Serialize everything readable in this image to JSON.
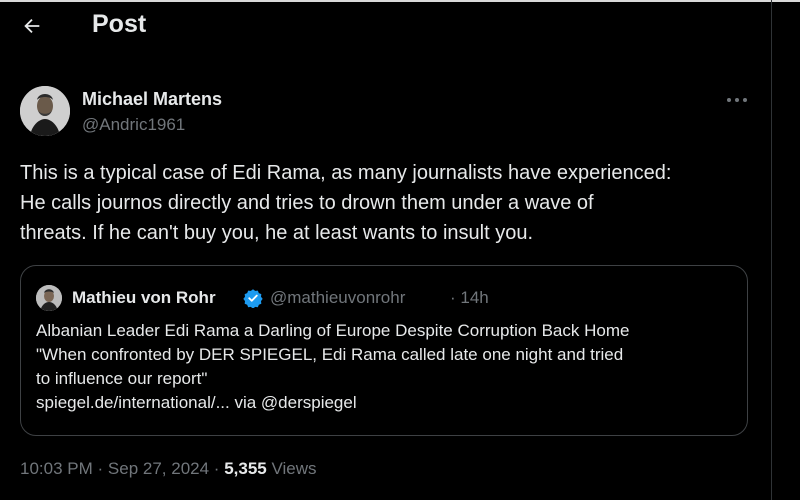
{
  "header": {
    "title": "Post",
    "back_icon": "arrow-left-icon"
  },
  "post": {
    "author": {
      "name": "Michael Martens",
      "handle": "@Andric1961",
      "avatar_icon": "user-avatar"
    },
    "more_icon": "more-horizontal-icon",
    "text_lines": [
      "This is a typical case of Edi Rama, as many journalists have experienced:",
      "He calls journos directly and tries to drown them under a wave of",
      "threats. If he can't buy you, he at least wants to insult you."
    ]
  },
  "quote": {
    "author": {
      "name": "Mathieu von Rohr",
      "handle": "@mathieuvonrohr",
      "time": "14h",
      "verified_icon": "verified-badge-icon"
    },
    "lines": [
      "Albanian Leader Edi Rama a Darling of Europe Despite Corruption Back Home",
      " \"When confronted by DER SPIEGEL, Edi Rama called late one night and tried",
      "to influence our report\"",
      "spiegel.de/international/... via @derspiegel"
    ]
  },
  "meta": {
    "time": "10:03 PM",
    "date": "Sep 27, 2024",
    "views_count": "5,355",
    "views_label": "Views"
  },
  "colors": {
    "background": "#000000",
    "text": "#e7e9ea",
    "muted": "#71767b",
    "border": "#3e4144",
    "verified": "#1d9bf0"
  }
}
